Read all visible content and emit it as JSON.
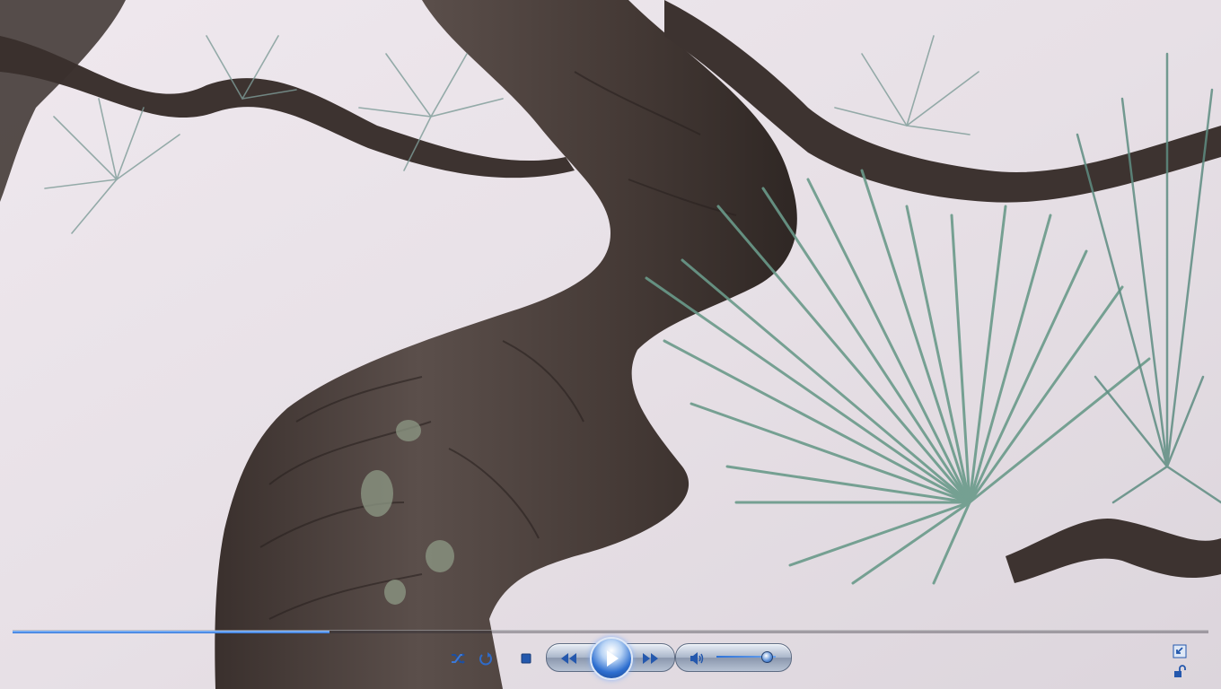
{
  "player": {
    "progress_fraction": 0.265,
    "volume_fraction": 0.84
  },
  "icons": {
    "shuffle": "shuffle-icon",
    "repeat": "repeat-icon",
    "stop": "stop-icon",
    "previous": "rewind-icon",
    "play": "play-icon",
    "next": "fast-forward-icon",
    "volume": "speaker-icon",
    "switch_view": "switch-to-library-icon",
    "full_screen": "fullscreen-icon"
  },
  "colors": {
    "accent": "#2f73d8",
    "sky": "#e8e2e8",
    "needles": "#5f8f82",
    "bark": "#4a3f3b"
  }
}
